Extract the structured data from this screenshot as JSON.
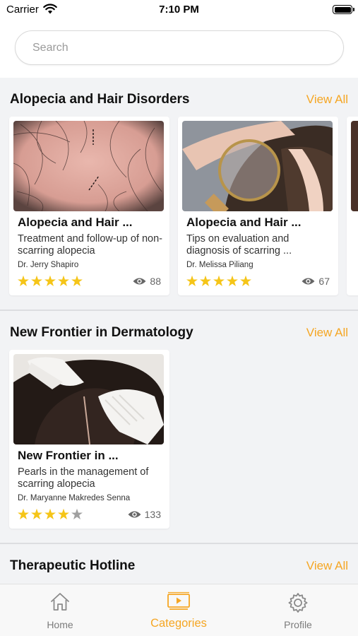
{
  "status_bar": {
    "carrier": "Carrier",
    "time": "7:10 PM"
  },
  "search": {
    "placeholder": "Search",
    "value": ""
  },
  "sections": [
    {
      "title": "Alopecia and Hair Disorders",
      "view_all": "View All",
      "cards": [
        {
          "title": "Alopecia and Hair ...",
          "description": "Treatment and follow-up of non-scarring alopecia",
          "author": "Dr. Jerry Shapiro",
          "rating": 5,
          "views": "88"
        },
        {
          "title": "Alopecia and Hair ...",
          "description": "Tips on evaluation and diagnosis of scarring ...",
          "author": "Dr. Melissa Piliang",
          "rating": 5,
          "views": "67"
        }
      ]
    },
    {
      "title": "New Frontier in Dermatology",
      "view_all": "View All",
      "cards": [
        {
          "title": "New Frontier in ...",
          "description": "Pearls in the management of scarring alopecia",
          "author": "Dr. Maryanne Makredes Senna",
          "rating": 4,
          "views": "133"
        }
      ]
    },
    {
      "title": "Therapeutic Hotline",
      "view_all": "View All",
      "cards": []
    }
  ],
  "tab_bar": {
    "items": [
      {
        "label": "Home",
        "icon": "home-icon"
      },
      {
        "label": "Categories",
        "icon": "video-player-icon",
        "active": true
      },
      {
        "label": "Profile",
        "icon": "gear-icon"
      }
    ]
  },
  "colors": {
    "accent": "#f5a623",
    "star_filled": "#f5c518",
    "star_empty": "#a0a0a0",
    "background": "#f2f3f5"
  }
}
